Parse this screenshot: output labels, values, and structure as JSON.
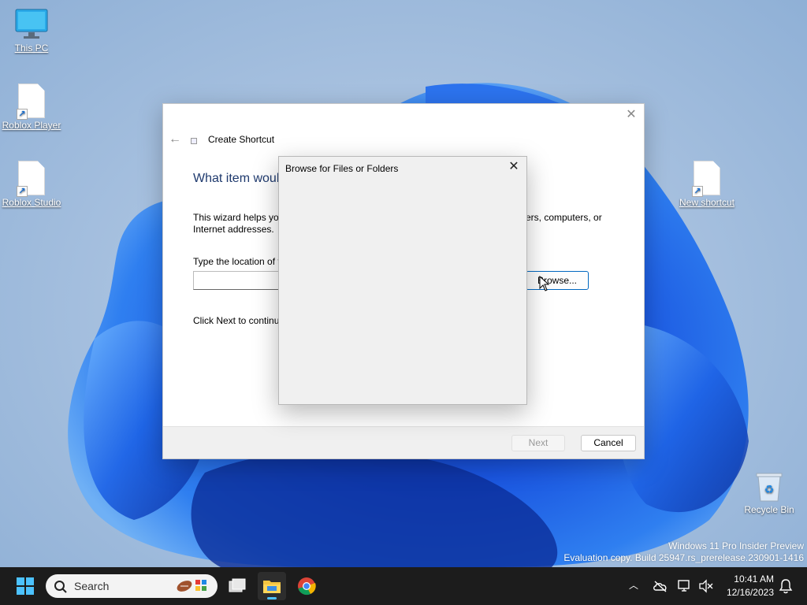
{
  "desktop": {
    "icons": [
      {
        "label": "This PC"
      },
      {
        "label": "Roblox Player"
      },
      {
        "label": "Roblox Studio"
      },
      {
        "label": "New shortcut"
      },
      {
        "label": "Recycle Bin"
      }
    ],
    "watermark": {
      "line1": "Windows 11 Pro Insider Preview",
      "line2": "Evaluation copy. Build 25947.rs_prerelease.230901-1416"
    }
  },
  "wizard": {
    "title": "Create Shortcut",
    "heading": "What item woul",
    "desc_left": "This wizard helps you",
    "desc_right": "ers, computers, or",
    "desc_line2": "Internet addresses.",
    "location_label": "Type the location of t",
    "location_value": "",
    "browse_label": "Browse...",
    "click_next": "Click Next to continu",
    "next_label": "Next",
    "cancel_label": "Cancel"
  },
  "browse_dialog": {
    "title": "Browse for Files or Folders"
  },
  "taskbar": {
    "search_placeholder": "Search",
    "time": "10:41 AM",
    "date": "12/16/2023"
  },
  "colors": {
    "accent": "#0067c0",
    "heading": "#1f3a6e",
    "taskbar": "#1c1c1c"
  }
}
